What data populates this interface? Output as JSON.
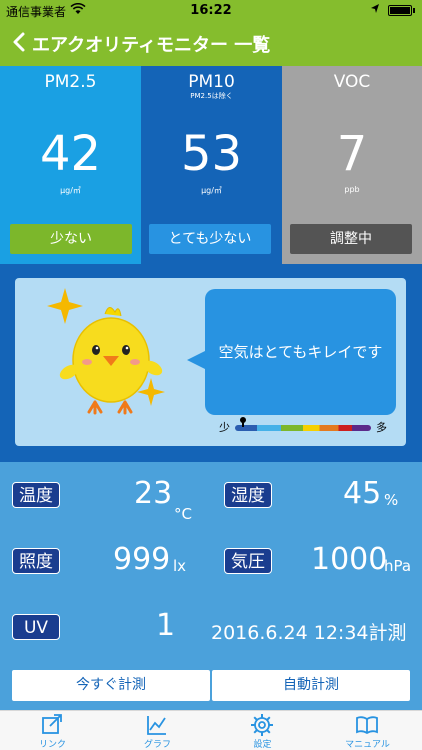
{
  "status_bar": {
    "carrier": "通信事業者",
    "time": "16:22"
  },
  "nav": {
    "title": "エアクオリティモニター 一覧"
  },
  "readings": [
    {
      "label": "PM2.5",
      "sublabel": "",
      "value": "42",
      "unit": "μg/㎥",
      "status": "少ない",
      "color": "#1aa0e3"
    },
    {
      "label": "PM10",
      "sublabel": "PM2.5は除く",
      "value": "53",
      "unit": "μg/㎥",
      "status": "とても少ない",
      "color": "#1464b7"
    },
    {
      "label": "VOC",
      "sublabel": "",
      "value": "7",
      "unit": "ppb",
      "status": "調整中",
      "color": "#a3a3a3"
    }
  ],
  "mascot": {
    "message": "空気はとてもキレイです",
    "scale_low": "少",
    "scale_high": "多"
  },
  "environment": {
    "temperature": {
      "label": "温度",
      "value": "23",
      "unit": "°C"
    },
    "humidity": {
      "label": "湿度",
      "value": "45",
      "unit": "%"
    },
    "illuminance": {
      "label": "照度",
      "value": "999",
      "unit": "lx"
    },
    "pressure": {
      "label": "気圧",
      "value": "1000",
      "unit": "hPa"
    },
    "uv": {
      "label": "UV",
      "value": "1"
    },
    "measured_at": "2016.6.24 12:34計測"
  },
  "actions": {
    "measure_now": "今すぐ計測",
    "auto_measure": "自動計測"
  },
  "tabs": [
    {
      "label": "リンク",
      "icon": "link-icon"
    },
    {
      "label": "グラフ",
      "icon": "graph-icon"
    },
    {
      "label": "設定",
      "icon": "gear-icon"
    },
    {
      "label": "マニュアル",
      "icon": "book-icon"
    }
  ]
}
